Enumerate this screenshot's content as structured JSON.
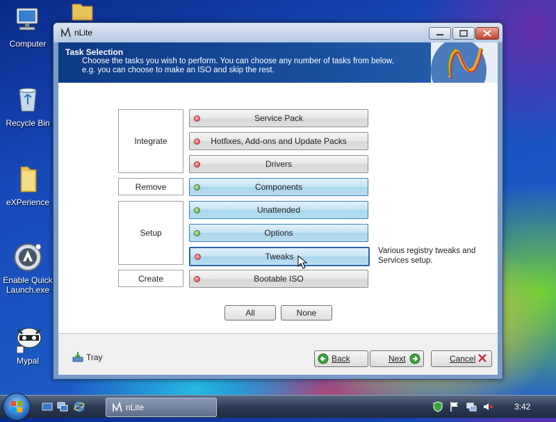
{
  "desktop": {
    "icons": [
      {
        "label": "Computer"
      },
      {
        "label": "Recycle Bin"
      },
      {
        "label": "eXPerience"
      },
      {
        "label": "Enable Quick Launch.exe"
      },
      {
        "label": "Mypal"
      }
    ]
  },
  "window": {
    "title": "nLite",
    "header": {
      "title": "Task Selection",
      "description": "Choose the tasks you wish to perform. You can choose any number of tasks from below, e.g. you can choose to make an ISO and skip the rest."
    },
    "groups": {
      "integrate": "Integrate",
      "remove": "Remove",
      "setup": "Setup",
      "create": "Create"
    },
    "tasks": [
      {
        "label": "Service Pack",
        "state": "off"
      },
      {
        "label": "Hotfixes, Add-ons and Update Packs",
        "state": "off"
      },
      {
        "label": "Drivers",
        "state": "off"
      },
      {
        "label": "Components",
        "state": "on"
      },
      {
        "label": "Unattended",
        "state": "on"
      },
      {
        "label": "Options",
        "state": "on"
      },
      {
        "label": "Tweaks",
        "state": "off"
      },
      {
        "label": "Bootable ISO",
        "state": "off"
      }
    ],
    "hover_description": "Various registry tweaks and Services setup.",
    "select_all_label": "All",
    "select_none_label": "None",
    "footer": {
      "tray_label": "Tray",
      "back_label": "Back",
      "next_label": "Next",
      "cancel_label": "Cancel"
    }
  },
  "taskbar": {
    "active_app": "nLite",
    "clock": "3:42"
  },
  "colors": {
    "header_bg": "#0e3a85",
    "selected_task": "#a8d6ee",
    "dot_on": "#4c9a3a",
    "dot_off": "#d4424a",
    "cancel_x": "#c8323c"
  }
}
